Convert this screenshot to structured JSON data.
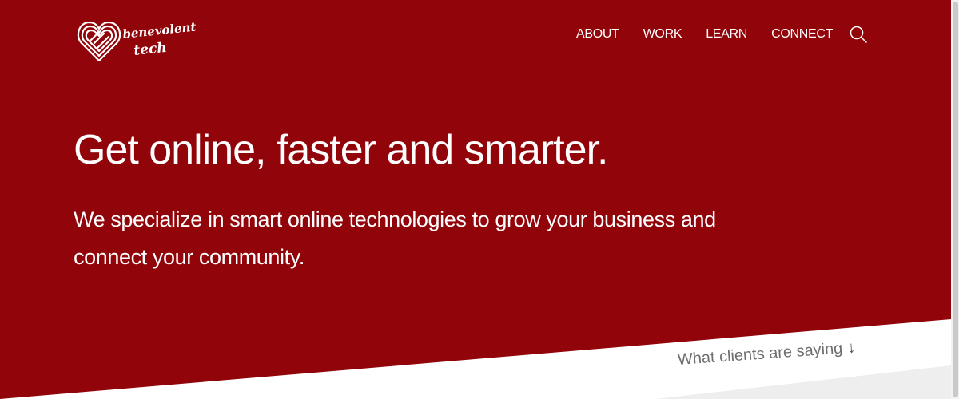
{
  "brand": {
    "line1": "benevolent",
    "line2": "tech"
  },
  "nav": {
    "items": [
      {
        "label": "ABOUT"
      },
      {
        "label": "WORK"
      },
      {
        "label": "LEARN"
      },
      {
        "label": "CONNECT"
      }
    ],
    "search_icon": "search-icon"
  },
  "hero": {
    "headline": "Get online, faster and smarter.",
    "subtext": "We specialize in smart online technologies to grow your business and connect your community."
  },
  "testimonials_link": {
    "label": "What clients are saying",
    "arrow": "↓"
  },
  "colors": {
    "brand_red": "#910409",
    "text_white": "#ffffff",
    "section_light": "#ffffff",
    "section_gray": "#eeeeee"
  }
}
